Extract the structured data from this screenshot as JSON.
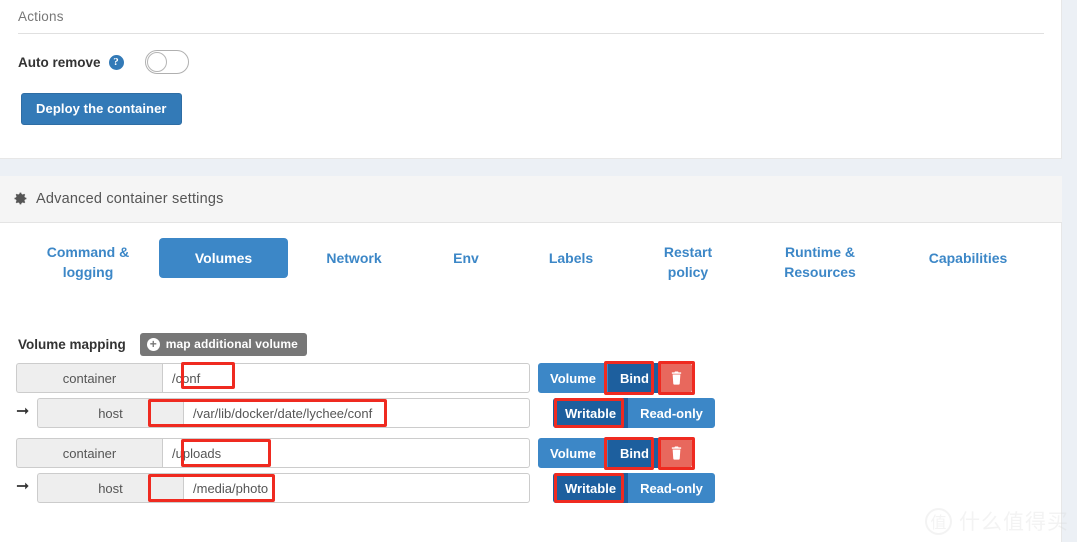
{
  "actions": {
    "title": "Actions",
    "auto_remove_label": "Auto remove",
    "help_icon": "question-circle-icon",
    "auto_remove_state": "off",
    "deploy_label": "Deploy the container"
  },
  "advanced": {
    "icon": "gear-icon",
    "title": "Advanced container settings",
    "tabs": [
      {
        "label": "Command & logging",
        "active": false
      },
      {
        "label": "Volumes",
        "active": true
      },
      {
        "label": "Network",
        "active": false
      },
      {
        "label": "Env",
        "active": false
      },
      {
        "label": "Labels",
        "active": false
      },
      {
        "label": "Restart policy",
        "active": false
      },
      {
        "label": "Runtime & Resources",
        "active": false
      },
      {
        "label": "Capabilities",
        "active": false
      }
    ]
  },
  "volumes": {
    "section_label": "Volume mapping",
    "add_button_label": "map additional volume",
    "add_button_icon": "plus-circle-icon",
    "delete_icon": "trash-icon",
    "arrow_icon": "arrow-right-icon",
    "type_options": [
      "Volume",
      "Bind"
    ],
    "access_options": [
      "Writable",
      "Read-only"
    ],
    "mappings": [
      {
        "container": {
          "addon": "container",
          "value": "/conf",
          "placeholder": "e.g. /path/in/container"
        },
        "type_selected": "Bind",
        "host": {
          "addon": "host",
          "value": "/var/lib/docker/date/lychee/conf",
          "placeholder": "e.g. /path/on/host"
        },
        "access_selected": "Writable"
      },
      {
        "container": {
          "addon": "container",
          "value": "/uploads",
          "placeholder": "e.g. /path/in/container"
        },
        "type_selected": "Bind",
        "host": {
          "addon": "host",
          "value": "/media/photo",
          "placeholder": "e.g. /path/on/host"
        },
        "access_selected": "Writable"
      }
    ]
  },
  "watermark": {
    "badge": "值",
    "text": "什么值得买"
  },
  "colors": {
    "primary_blue": "#337ab7",
    "tab_blue": "#3c87c7",
    "active_dark_blue": "#1d5f9e",
    "danger_red": "#e8685d",
    "annotation_red": "#ef2a20",
    "addon_gray": "#eeeeee",
    "page_bg": "#ecf0f5"
  }
}
